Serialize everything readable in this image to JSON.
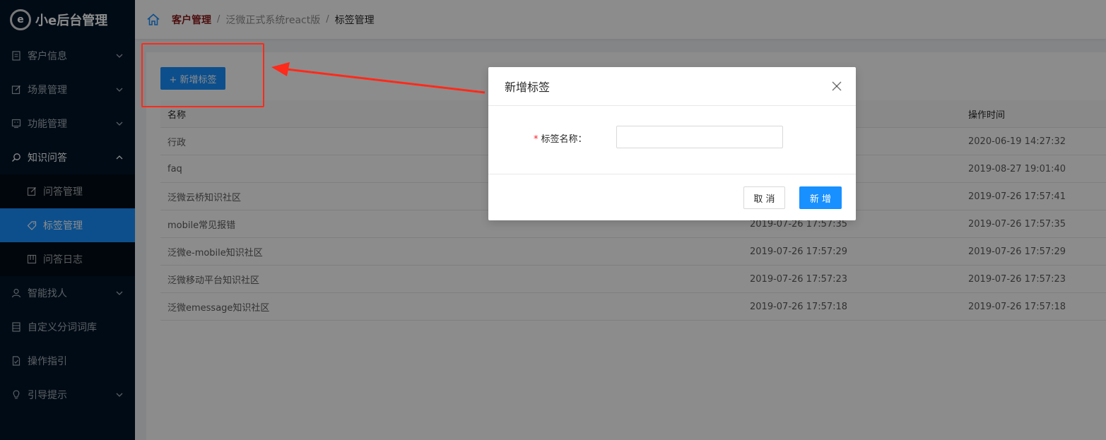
{
  "app": {
    "logo_text": "小e后台管理",
    "logo_mark": "e"
  },
  "sidebar": {
    "items": [
      {
        "label": "客户信息",
        "icon": "file-icon",
        "expandable": true
      },
      {
        "label": "场景管理",
        "icon": "edit-icon",
        "expandable": true
      },
      {
        "label": "功能管理",
        "icon": "monitor-icon",
        "expandable": true
      },
      {
        "label": "知识问答",
        "icon": "search-icon",
        "expandable": true,
        "expanded": true,
        "children": [
          {
            "label": "问答管理",
            "icon": "edit-icon"
          },
          {
            "label": "标签管理",
            "icon": "tag-icon",
            "active": true
          },
          {
            "label": "问答日志",
            "icon": "book-icon"
          }
        ]
      },
      {
        "label": "智能找人",
        "icon": "user-icon",
        "expandable": true
      },
      {
        "label": "自定义分词词库",
        "icon": "database-icon",
        "expandable": false
      },
      {
        "label": "操作指引",
        "icon": "document-icon",
        "expandable": false
      },
      {
        "label": "引导提示",
        "icon": "bulb-icon",
        "expandable": true
      }
    ]
  },
  "breadcrumb": [
    "客户管理",
    "泛微正式系统react版",
    "标签管理"
  ],
  "toolbar": {
    "add_label": "+ 新增标签"
  },
  "table": {
    "headers": [
      "名称",
      "",
      "操作时间"
    ],
    "rows": [
      {
        "name": "行政",
        "time1": "",
        "time2": "2020-06-19 14:27:32"
      },
      {
        "name": "faq",
        "time1": "",
        "time2": "2019-08-27 19:01:40"
      },
      {
        "name": "泛微云桥知识社区",
        "time1": "",
        "time2": "2019-07-26 17:57:41"
      },
      {
        "name": "mobile常见报错",
        "time1": "2019-07-26 17:57:35",
        "time2": "2019-07-26 17:57:35"
      },
      {
        "name": "泛微e-mobile知识社区",
        "time1": "2019-07-26 17:57:29",
        "time2": "2019-07-26 17:57:29"
      },
      {
        "name": "泛微移动平台知识社区",
        "time1": "2019-07-26 17:57:23",
        "time2": "2019-07-26 17:57:23"
      },
      {
        "name": "泛微emessage知识社区",
        "time1": "2019-07-26 17:57:18",
        "time2": "2019-07-26 17:57:18"
      }
    ]
  },
  "modal": {
    "title": "新增标签",
    "field_label": "标签名称：",
    "field_required_mark": "*",
    "field_value": "",
    "cancel_label": "取 消",
    "ok_label": "新 增"
  },
  "colors": {
    "primary": "#1890ff",
    "sidebar_bg": "#001529",
    "annotation": "#ff2a1a"
  }
}
